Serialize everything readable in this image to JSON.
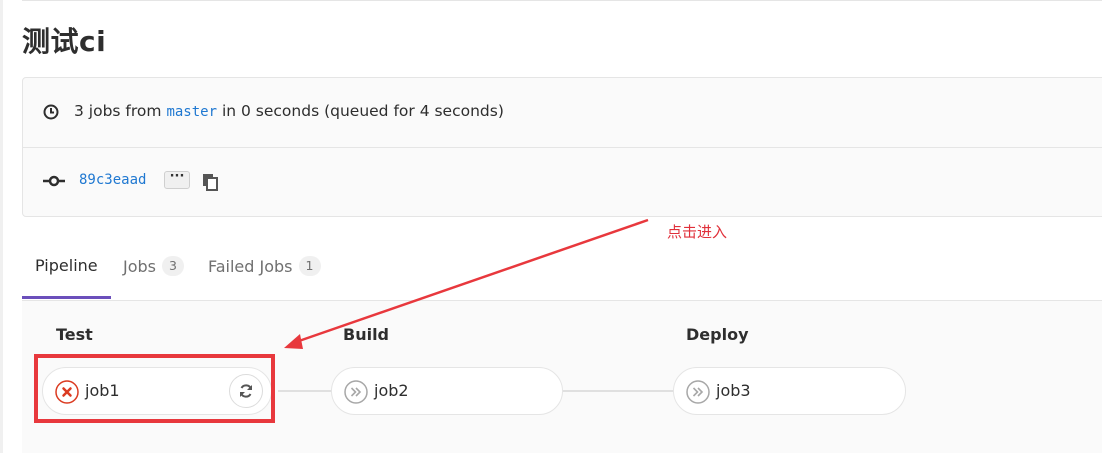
{
  "page": {
    "title": "测试ci"
  },
  "summary": {
    "prefix": "3 jobs from",
    "branch": "master",
    "suffix": "in 0 seconds (queued for 4 seconds)"
  },
  "commit": {
    "sha": "89c3eaad",
    "more_label": "···"
  },
  "annotation": {
    "text": "点击进入",
    "color": "#e0303a"
  },
  "tabs": [
    {
      "label": "Pipeline",
      "active": true
    },
    {
      "label": "Jobs",
      "count": "3"
    },
    {
      "label": "Failed Jobs",
      "count": "1"
    }
  ],
  "stages": [
    {
      "name": "Test",
      "jobs": [
        {
          "name": "job1",
          "status": "failed",
          "icon": "status-failed-icon",
          "action": "retry-icon"
        }
      ]
    },
    {
      "name": "Build",
      "jobs": [
        {
          "name": "job2",
          "status": "skipped",
          "icon": "status-skipped-icon"
        }
      ]
    },
    {
      "name": "Deploy",
      "jobs": [
        {
          "name": "job3",
          "status": "skipped",
          "icon": "status-skipped-icon"
        }
      ]
    }
  ],
  "colors": {
    "accent": "#6b4fbb",
    "link": "#1f78d1",
    "failed": "#db3b21",
    "highlight": "#e8383d"
  }
}
